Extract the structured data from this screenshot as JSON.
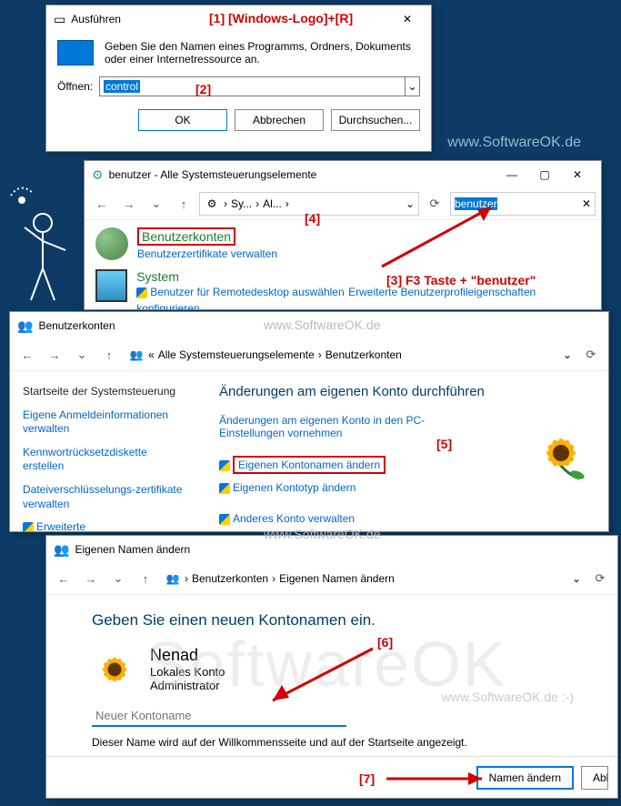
{
  "watermarks": {
    "top": "www.SoftwareOK.de",
    "mid": "www.SoftwareOK.de",
    "mid2": "www.SoftwareOK.de",
    "big": "SoftwareOK",
    "bottom": "www.SoftwareOK.de :-)"
  },
  "annotations": {
    "a1": "[1]  [Windows-Logo]+[R]",
    "a2": "[2]",
    "a3": "[3] F3 Taste + \"benutzer\"",
    "a4": "[4]",
    "a5": "[5]",
    "a6": "[6]",
    "a7": "[7]"
  },
  "run": {
    "title": "Ausführen",
    "desc": "Geben Sie den Namen eines Programms, Ordners, Dokuments oder einer Internetressource an.",
    "open_label": "Öffnen:",
    "value": "control",
    "ok": "OK",
    "cancel": "Abbrechen",
    "browse": "Durchsuchen..."
  },
  "search": {
    "title": "benutzer - Alle Systemsteuerungselemente",
    "bc1": "Sy...",
    "bc2": "Al...",
    "query": "benutzer",
    "r1_title": "Benutzerkonten",
    "r1_sub": "Benutzerzertifikate verwalten",
    "r2_title": "System",
    "r2_sub1": "Benutzer für Remotedesktop auswählen",
    "r2_sub2": "Erweiterte Benutzerprofileigenschaften konfigurieren"
  },
  "ua": {
    "title": "Benutzerkonten",
    "bc_root": "Alle Systemsteuerungselemente",
    "bc_leaf": "Benutzerkonten",
    "side": {
      "home": "Startseite der Systemsteuerung",
      "l1": "Eigene Anmeldeinformationen verwalten",
      "l2": "Kennwortrücksetzdiskette erstellen",
      "l3": "Dateiverschlüsselungs-zertifikate verwalten",
      "l4": "Erweiterte Benutzerprofileigenschaften konfigurieren"
    },
    "heading": "Änderungen am eigenen Konto durchführen",
    "m1": "Änderungen am eigenen Konto in den PC-Einstellungen vornehmen",
    "m2": "Eigenen Kontonamen ändern",
    "m3": "Eigenen Kontotyp ändern",
    "m4": "Anderes Konto verwalten"
  },
  "rename": {
    "title": "Eigenen Namen ändern",
    "bc1": "Benutzerkonten",
    "bc2": "Eigenen Namen ändern",
    "heading": "Geben Sie einen neuen Kontonamen ein.",
    "user": "Nenad",
    "type": "Lokales Konto",
    "role": "Administrator",
    "placeholder": "Neuer Kontoname",
    "hint": "Dieser Name wird auf der Willkommensseite und auf der Startseite angezeigt.",
    "btn_ok": "Namen ändern",
    "btn_cancel": "Abl"
  }
}
